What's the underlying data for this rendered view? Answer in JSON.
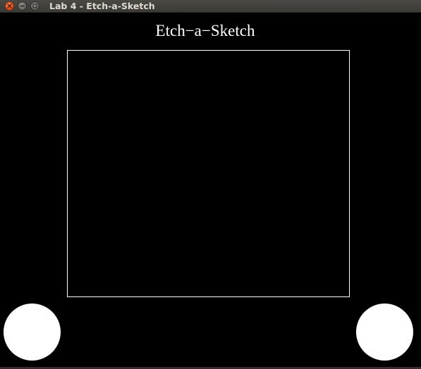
{
  "window": {
    "title": "Lab 4 - Etch-a-Sketch",
    "controls": {
      "close_icon": "close-icon",
      "minimize_icon": "minimize-icon",
      "maximize_icon": "maximize-icon"
    }
  },
  "app": {
    "heading": "Etch−a−Sketch",
    "colors": {
      "background": "#000000",
      "foreground": "#ffffff"
    }
  }
}
